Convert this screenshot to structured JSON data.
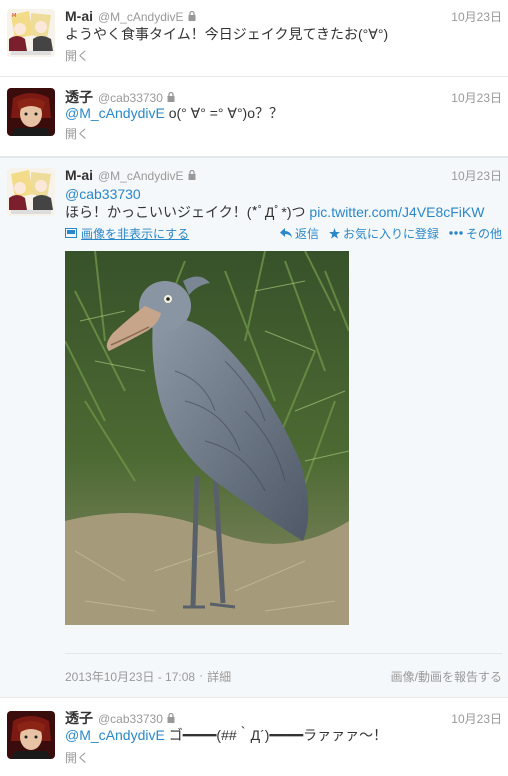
{
  "tweets": [
    {
      "fullname": "M-ai",
      "username": "@M_cAndydivE",
      "time": "10月23日",
      "text": "ようやく食事タイム！今日ジェイク見てきたお(°∀°)",
      "expand": "開く"
    },
    {
      "fullname": "透子",
      "username": "@cab33730",
      "time": "10月23日",
      "mention": "@M_cAndydivE",
      "text": " ο(° ∀° =° ∀°)ο？？",
      "expand": "開く"
    },
    {
      "fullname": "M-ai",
      "username": "@M_cAndydivE",
      "time": "10月23日",
      "mention": "@cab33730",
      "text": "ほら！かっこいいジェイク！(*ﾟДﾟ*)つ ",
      "link": "pic.twitter.com/J4VE8cFiKW",
      "hide_media": "画像を非表示にする",
      "reply": "返信",
      "favorite": "お気に入りに登録",
      "more": "その他",
      "timestamp": "2013年10月23日 - 17:08",
      "details": "詳細",
      "report": "画像/動画を報告する"
    },
    {
      "fullname": "透子",
      "username": "@cab33730",
      "time": "10月23日",
      "mention": "@M_cAndydivE",
      "text": " ゴ━━━━(##｀Д´)━━━━ラァァァ〜！",
      "expand": "開く"
    }
  ],
  "colors": {
    "link": "#2a87c8",
    "meta": "#999999",
    "text": "#333333"
  }
}
